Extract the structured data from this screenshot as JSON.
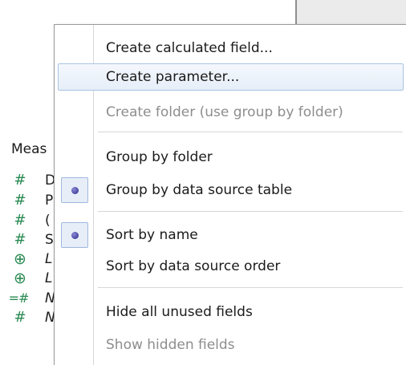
{
  "data_pane": {
    "header": "Meas",
    "fields": [
      {
        "icon": "number-icon",
        "glyph": "#",
        "name": "D",
        "italic": false
      },
      {
        "icon": "number-icon",
        "glyph": "#",
        "name": "P",
        "italic": false
      },
      {
        "icon": "number-icon",
        "glyph": "#",
        "name": "(",
        "italic": false
      },
      {
        "icon": "number-icon",
        "glyph": "#",
        "name": "S",
        "italic": false
      },
      {
        "icon": "globe-icon",
        "glyph": "⊕",
        "name": "L",
        "italic": true
      },
      {
        "icon": "globe-icon",
        "glyph": "⊕",
        "name": "L",
        "italic": true
      },
      {
        "icon": "calculated-number-icon",
        "glyph": "=#",
        "name": "N",
        "italic": true
      },
      {
        "icon": "number-icon",
        "glyph": "#",
        "name": "N",
        "italic": true
      }
    ]
  },
  "menu": {
    "items": [
      {
        "label": "Create calculated field...",
        "state": "normal"
      },
      {
        "label": "Create parameter...",
        "state": "highlighted"
      },
      {
        "label": "Create folder (use group by folder)",
        "state": "disabled"
      },
      {
        "label": "Group by folder",
        "state": "normal"
      },
      {
        "label": "Group by data source table",
        "state": "checked"
      },
      {
        "label": "Sort by name",
        "state": "checked"
      },
      {
        "label": "Sort by data source order",
        "state": "normal"
      },
      {
        "label": "Hide all unused fields",
        "state": "normal"
      },
      {
        "label": "Show hidden fields",
        "state": "disabled"
      }
    ]
  },
  "colors": {
    "field_icon": "#2a8a52",
    "highlight_border": "#a9c3e3",
    "radio_dot": "#2b2a86",
    "disabled_text": "#8d8d8d"
  }
}
